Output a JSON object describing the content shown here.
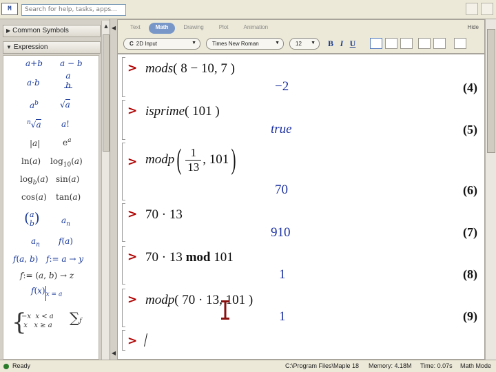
{
  "search": {
    "placeholder": "Search for help, tasks, apps..."
  },
  "palettes": {
    "common_symbols_label": "Common Symbols",
    "expression_label": "Expression",
    "expression_items": [
      "a + b",
      "a − b",
      "a · b",
      "a/b",
      "a^b",
      "√a",
      "ⁿ√a",
      "a!",
      "|a|",
      "e^a",
      "ln(a)",
      "log10(a)",
      "log_b(a)",
      "sin(a)",
      "cos(a)",
      "tan(a)",
      "(a b)",
      "a_n",
      "a_n",
      "f(a)",
      "f(a, b)",
      "f := a → y",
      "f := (a, b) → z",
      "f(x)|x = a",
      "piecewise",
      "Σ"
    ]
  },
  "toolbar": {
    "tabs": [
      {
        "label": "Text",
        "active": false
      },
      {
        "label": "Math",
        "active": true
      },
      {
        "label": "Drawing",
        "active": false
      },
      {
        "label": "Plot",
        "active": false
      },
      {
        "label": "Animation",
        "active": false
      }
    ],
    "hide_label": "Hide",
    "input_mode": "2D Input",
    "font": "Times New Roman",
    "font_size": "12",
    "bold": "B",
    "italic": "I",
    "underline": "U"
  },
  "worksheet": {
    "rows": [
      {
        "id": "r4",
        "input_fn": "mods",
        "input_args": "( 8 − 10, 7 )",
        "output": "−2",
        "label": "(4)"
      },
      {
        "id": "r5",
        "input_fn": "isprime",
        "input_args": "( 101 )",
        "output": "true",
        "label": "(5)"
      },
      {
        "id": "r6",
        "input_fn": "modp",
        "frac_num": "1",
        "frac_den": "13",
        "input_tail": ", 101",
        "output": "70",
        "label": "(6)"
      },
      {
        "id": "r7",
        "input_plain": "70 · 13",
        "output": "910",
        "label": "(7)"
      },
      {
        "id": "r8",
        "input_plain": "70 · 13",
        "input_kw": "mod",
        "input_tail": "101",
        "output": "1",
        "label": "(8)"
      },
      {
        "id": "r9",
        "input_fn": "modp",
        "input_args": "( 70 · 13, 101 )",
        "output": "1",
        "label": "(9)"
      }
    ]
  },
  "status": {
    "ready": "Ready",
    "path": "C:\\Program Files\\Maple 18",
    "memory": "Memory: 4.18M",
    "time": "Time: 0.07s",
    "mode": "Math Mode"
  },
  "colors": {
    "prompt": "#b00000",
    "output": "#1a2fa0",
    "active_tab": "#7897c8"
  }
}
